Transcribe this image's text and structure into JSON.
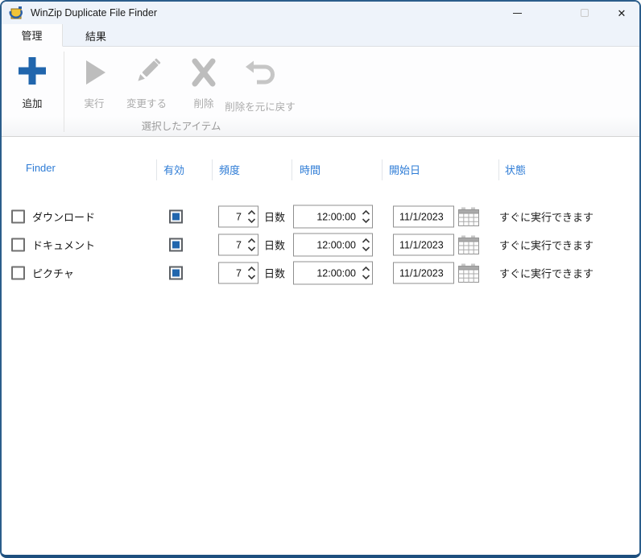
{
  "window": {
    "title": "WinZip Duplicate File Finder"
  },
  "tabs": [
    {
      "label": "管理",
      "active": true
    },
    {
      "label": "結果",
      "active": false
    }
  ],
  "toolbar": {
    "add_label": "追加",
    "run_label": "実行",
    "change_label": "変更する",
    "delete_label": "削除",
    "undo_delete_label": "削除を元に戻す",
    "group_label": "選択したアイテム"
  },
  "table": {
    "headers": [
      "Finder",
      "有効",
      "頻度",
      "時間",
      "開始日",
      "状態"
    ],
    "days_label": "日数",
    "rows": [
      {
        "name": "ダウンロード",
        "enabled": true,
        "frequency": "7",
        "time": "12:00:00",
        "start_date": "11/1/2023",
        "status": "すぐに実行できます"
      },
      {
        "name": "ドキュメント",
        "enabled": true,
        "frequency": "7",
        "time": "12:00:00",
        "start_date": "11/1/2023",
        "status": "すぐに実行できます"
      },
      {
        "name": "ピクチャ",
        "enabled": true,
        "frequency": "7",
        "time": "12:00:00",
        "start_date": "11/1/2023",
        "status": "すぐに実行できます"
      }
    ]
  },
  "colors": {
    "accent_blue": "#2166ad",
    "header_blue": "#2e7cd6",
    "window_border": "#2b5d8b",
    "window_border_bottom": "#1d4f7e",
    "disabled_gray": "#bdbdbd"
  }
}
